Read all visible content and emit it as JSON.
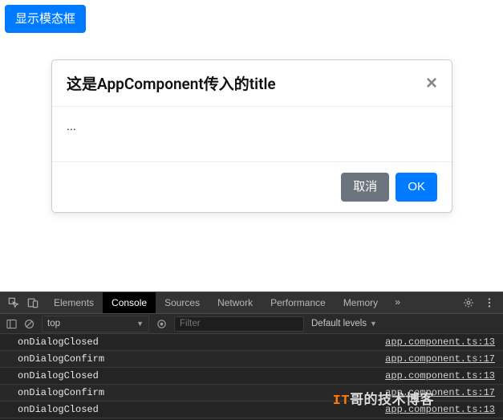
{
  "trigger_button": {
    "label": "显示模态框"
  },
  "modal": {
    "title": "这是AppComponent传入的title",
    "body": "...",
    "cancel_label": "取消",
    "ok_label": "OK"
  },
  "devtools": {
    "tabs": [
      "Elements",
      "Console",
      "Sources",
      "Network",
      "Performance",
      "Memory"
    ],
    "active_tab_index": 1,
    "more_glyph": "»",
    "toolbar": {
      "context": "top",
      "filter_placeholder": "Filter",
      "levels_label": "Default levels"
    },
    "logs": [
      {
        "msg": "onDialogClosed",
        "src": "app.component.ts:13"
      },
      {
        "msg": "onDialogConfirm",
        "src": "app.component.ts:17"
      },
      {
        "msg": "onDialogClosed",
        "src": "app.component.ts:13"
      },
      {
        "msg": "onDialogConfirm",
        "src": "app.component.ts:17"
      },
      {
        "msg": "onDialogClosed",
        "src": "app.component.ts:13"
      }
    ]
  },
  "watermark": {
    "t1": "IT",
    "t2": "哥的技术博客"
  }
}
